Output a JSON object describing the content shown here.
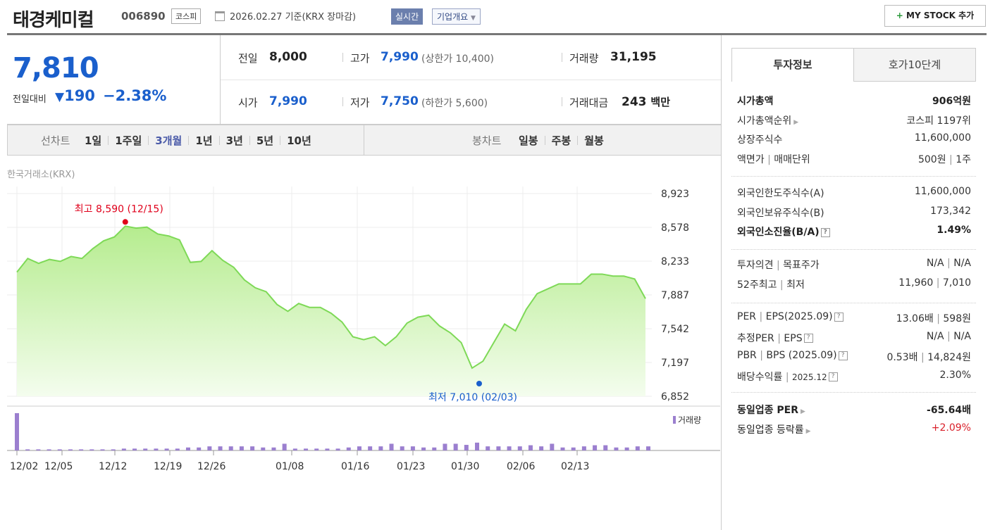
{
  "header": {
    "name": "태경케미컬",
    "code": "006890",
    "market": "코스피",
    "date": "2026.02.27  기준(KRX 장마감)",
    "realtime": "실시간",
    "company_btn": "기업개요",
    "mystock": "MY STOCK 추가"
  },
  "quote": {
    "price": "7,810",
    "change_label": "전일대비",
    "change": "190",
    "change_pct": "−2.38%",
    "prev_label": "전일",
    "prev": "8,000",
    "high_label": "고가",
    "high": "7,990",
    "upper": "(상한가 10,400)",
    "volume_label": "거래량",
    "volume": "31,195",
    "open_label": "시가",
    "open": "7,990",
    "low_label": "저가",
    "low": "7,750",
    "lower": "(하한가 5,600)",
    "amount_label": "거래대금",
    "amount": "243",
    "amount_unit": "백만"
  },
  "tabs": {
    "line_label": "선차트",
    "line": [
      "1일",
      "1주일",
      "3개월",
      "1년",
      "3년",
      "5년",
      "10년"
    ],
    "active": "3개월",
    "candle_label": "봉차트",
    "candle": [
      "일봉",
      "주봉",
      "월봉"
    ]
  },
  "chart": {
    "source": "한국거래소(KRX)",
    "high_note": "최고 8,590 (12/15)",
    "low_note": "최저 7,010 (02/03)",
    "volume_legend": "거래량",
    "colors": {
      "line": "#7ed957",
      "fill_top": "#b5ec8e",
      "high": "#e0001b",
      "low": "#1a5fcc",
      "volume": "#9b7fcf"
    }
  },
  "chart_data": {
    "type": "area",
    "y_ticks": [
      "8,923",
      "8,578",
      "8,233",
      "7,887",
      "7,542",
      "7,197",
      "6,852"
    ],
    "ylim": [
      6852,
      8923
    ],
    "x_ticks": [
      "12/02",
      "12/05",
      "12/12",
      "12/19",
      "12/26",
      "01/08",
      "01/16",
      "01/23",
      "01/30",
      "02/06",
      "02/13"
    ],
    "values": [
      8120,
      8260,
      8210,
      8250,
      8230,
      8280,
      8260,
      8360,
      8440,
      8480,
      8590,
      8570,
      8580,
      8510,
      8490,
      8450,
      8220,
      8230,
      8340,
      8240,
      8170,
      8040,
      7960,
      7920,
      7790,
      7720,
      7800,
      7760,
      7760,
      7700,
      7610,
      7460,
      7430,
      7460,
      7370,
      7460,
      7600,
      7660,
      7680,
      7570,
      7500,
      7400,
      7140,
      7210,
      7400,
      7590,
      7520,
      7740,
      7900,
      7950,
      8000,
      8000,
      8000,
      8100,
      8100,
      8080,
      8080,
      8050,
      7850
    ],
    "volume": [
      100,
      3,
      3,
      3,
      3,
      3,
      3,
      3,
      3,
      3,
      5,
      5,
      5,
      5,
      5,
      5,
      8,
      8,
      11,
      11,
      11,
      11,
      11,
      8,
      8,
      18,
      5,
      5,
      5,
      5,
      5,
      8,
      11,
      11,
      11,
      18,
      11,
      11,
      8,
      8,
      18,
      18,
      15,
      21,
      11,
      11,
      11,
      11,
      14,
      11,
      18,
      8,
      8,
      11,
      14,
      14,
      8,
      8,
      11,
      11
    ]
  },
  "invest": {
    "tab1": "투자정보",
    "tab2": "호가10단계",
    "rows1": [
      {
        "l": "시가총액",
        "r": "906억원"
      },
      {
        "l": "시가총액순위",
        "r": "코스피 1197위"
      },
      {
        "l": "상장주식수",
        "r": "11,600,000"
      },
      {
        "l": "액면가",
        "l2": "매매단위",
        "r": "500원",
        "r2": "1주"
      }
    ],
    "rows2": [
      {
        "l": "외국인한도주식수(A)",
        "r": "11,600,000"
      },
      {
        "l": "외국인보유주식수(B)",
        "r": "173,342"
      },
      {
        "l": "외국인소진율(B/A)",
        "r": "1.49%"
      }
    ],
    "rows3": [
      {
        "l": "투자의견",
        "l2": "목표주가",
        "r": "N/A",
        "r2": "N/A"
      },
      {
        "l": "52주최고",
        "l2": "최저",
        "r": "11,960",
        "r2": "7,010"
      }
    ],
    "rows4": [
      {
        "l": "PER",
        "l2": "EPS(2025.09)",
        "r": "13.06배",
        "r2": "598원"
      },
      {
        "l": "추정PER",
        "l2": "EPS",
        "r": "N/A",
        "r2": "N/A"
      },
      {
        "l": "PBR",
        "l2": "BPS (2025.09)",
        "r": "0.53배",
        "r2": "14,824원"
      },
      {
        "l": "배당수익률",
        "l2": "2025.12",
        "r": "2.30%"
      }
    ],
    "rows5": [
      {
        "l": "동일업종 PER",
        "r": "-65.64배"
      },
      {
        "l": "동일업종 등락률",
        "r": "+2.09%"
      }
    ]
  }
}
